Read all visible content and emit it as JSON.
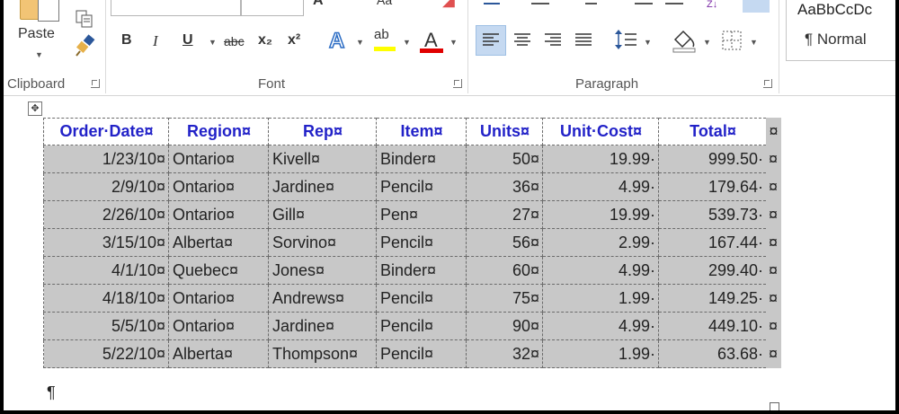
{
  "ribbon": {
    "clipboard": {
      "label": "Clipboard",
      "paste_label": "Paste"
    },
    "font": {
      "label": "Font",
      "bold": "B",
      "italic": "I",
      "underline": "U",
      "strike": "abc",
      "subscript": "x₂",
      "superscript": "x²",
      "text_effects": "A",
      "highlight": "ab",
      "font_color": "A",
      "highlight_color": "#ffff00",
      "font_color_bar": "#e00000"
    },
    "paragraph": {
      "label": "Paragraph"
    },
    "styles": {
      "sample": "AaBbCcDc",
      "name": "¶ Normal"
    }
  },
  "table": {
    "headers": [
      "Order·Date¤",
      "Region¤",
      "Rep¤",
      "Item¤",
      "Units¤",
      "Unit·Cost¤",
      "Total¤",
      "¤"
    ],
    "rows": [
      [
        "1/23/10¤",
        "Ontario¤",
        "Kivell¤",
        "Binder¤",
        "50¤",
        "19.99·",
        "999.50·",
        "¤"
      ],
      [
        "2/9/10¤",
        "Ontario¤",
        "Jardine¤",
        "Pencil¤",
        "36¤",
        "4.99·",
        "179.64·",
        "¤"
      ],
      [
        "2/26/10¤",
        "Ontario¤",
        "Gill¤",
        "Pen¤",
        "27¤",
        "19.99·",
        "539.73·",
        "¤"
      ],
      [
        "3/15/10¤",
        "Alberta¤",
        "Sorvino¤",
        "Pencil¤",
        "56¤",
        "2.99·",
        "167.44·",
        "¤"
      ],
      [
        "4/1/10¤",
        "Quebec¤",
        "Jones¤",
        "Binder¤",
        "60¤",
        "4.99·",
        "299.40·",
        "¤"
      ],
      [
        "4/18/10¤",
        "Ontario¤",
        "Andrews¤",
        "Pencil¤",
        "75¤",
        "1.99·",
        "149.25·",
        "¤"
      ],
      [
        "5/5/10¤",
        "Ontario¤",
        "Jardine¤",
        "Pencil¤",
        "90¤",
        "4.99·",
        "449.10·",
        "¤"
      ],
      [
        "5/22/10¤",
        "Alberta¤",
        "Thompson¤",
        "Pencil¤",
        "32¤",
        "1.99·",
        "63.68·",
        "¤"
      ]
    ]
  },
  "doc": {
    "pilcrow": "¶",
    "move_handle": "✥"
  }
}
